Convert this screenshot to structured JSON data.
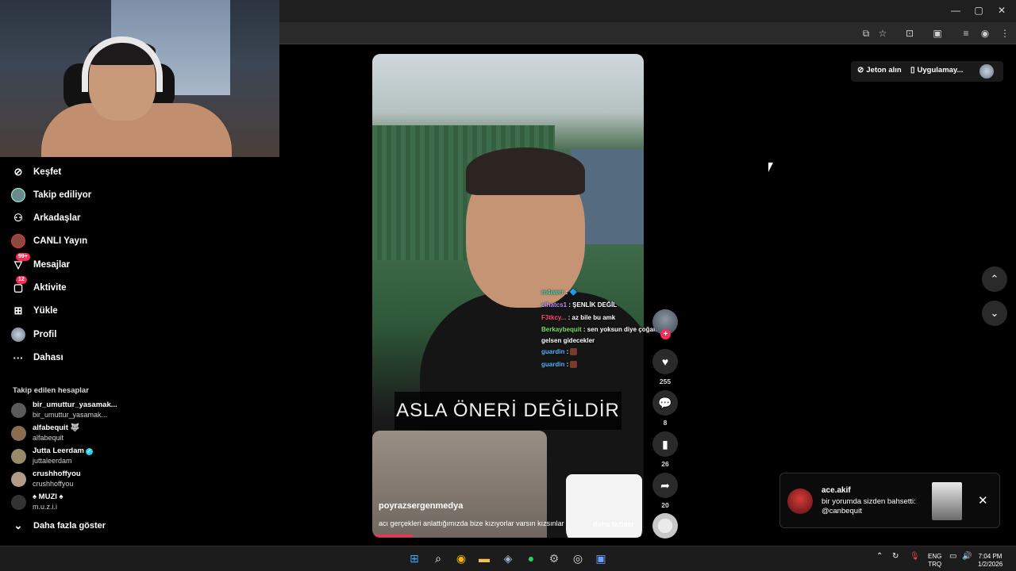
{
  "browser": {
    "window_controls": [
      "—",
      "▢",
      "✕"
    ],
    "toolbar_icons": [
      "install-icon",
      "star-icon",
      "extensions-icon",
      "split-icon",
      "media-icon",
      "profile-icon",
      "menu-icon"
    ]
  },
  "sidebar": {
    "nav": [
      {
        "label": "Keşfet",
        "icon": "compass-icon",
        "glyph": "⊘"
      },
      {
        "label": "Takip ediliyor",
        "icon": "following-avatar-icon",
        "glyph": ""
      },
      {
        "label": "Arkadaşlar",
        "icon": "friends-icon",
        "glyph": "👥"
      },
      {
        "label": "CANLI Yayın",
        "icon": "live-avatar-icon",
        "glyph": ""
      },
      {
        "label": "Mesajlar",
        "icon": "messages-icon",
        "glyph": "▽",
        "badge": "99+"
      },
      {
        "label": "Aktivite",
        "icon": "activity-icon",
        "glyph": "▢",
        "badge": "12"
      },
      {
        "label": "Yükle",
        "icon": "upload-icon",
        "glyph": "⊞"
      },
      {
        "label": "Profil",
        "icon": "profile-avatar-icon",
        "glyph": ""
      },
      {
        "label": "Dahası",
        "icon": "more-icon",
        "glyph": "···"
      }
    ],
    "followed_title": "Takip edilen hesaplar",
    "accounts": [
      {
        "name": "bir_umuttur_yasamak...",
        "handle": "bir_umuttur_yasamak...",
        "color": "#5b5b5b"
      },
      {
        "name": "alfabequit 🐺",
        "handle": "alfabequit",
        "color": "#8a6d4f"
      },
      {
        "name": "Jutta Leerdam",
        "handle": "juttaleerdam",
        "color": "#9a8a6c",
        "verified": true
      },
      {
        "name": "crushhoffyou",
        "handle": "crushhoffyou",
        "color": "#b09a88"
      },
      {
        "name": "♠ MUZI ♠",
        "handle": "m.u.z.i.i",
        "color": "#333"
      }
    ],
    "show_more": "Daha fazla göster"
  },
  "header": {
    "coins_label": "Jeton alın",
    "app_label": "Uygulamay..."
  },
  "video": {
    "caption_overlay": "ASLA ÖNERİ DEĞİLDİR",
    "author": "poyrazsergenmedya",
    "description": "acı gerçekleri anlattığımızda bize kızıyorlar varsın kızsınlar",
    "more": "daha fazlası",
    "progress_fraction": 0.15
  },
  "chat": [
    {
      "user": "m4werr",
      "text": ": 🔷"
    },
    {
      "user": "cihatcs1",
      "text": ": ŞENLİK DEĞİL"
    },
    {
      "user": "F3tkcy...",
      "text": ": az bile bu amk"
    },
    {
      "user": "Berkaybequit",
      "text": ": sen yoksun diye çoğaldılar"
    },
    {
      "user": "",
      "text": "gelsen gidecekler"
    },
    {
      "user": "guardin",
      "text": ":"
    },
    {
      "user": "guardin",
      "text": ":"
    }
  ],
  "actions": {
    "likes": "255",
    "comments": "8",
    "saves": "26",
    "shares": "20"
  },
  "notification": {
    "user": "ace.akif",
    "message": "bir yorumda sizden bahsetti: @canbequit"
  },
  "taskbar": {
    "lang": "ENG",
    "region": "TRQ",
    "time": "7:04 PM",
    "date": "1/2/2026"
  }
}
